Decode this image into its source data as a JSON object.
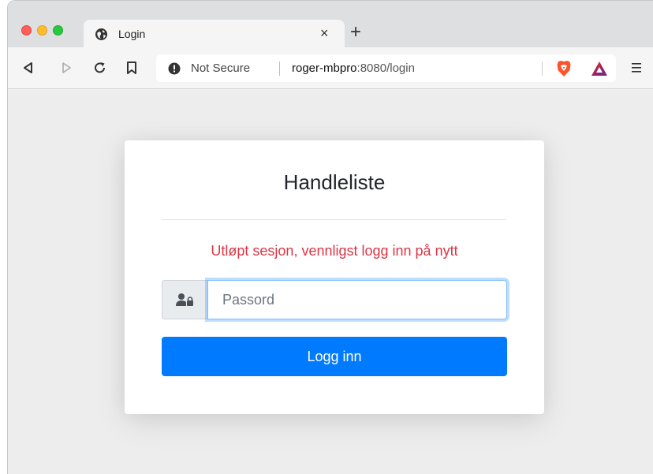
{
  "browser": {
    "tab": {
      "title": "Login",
      "close": "×"
    },
    "new_tab": "+",
    "omnibox": {
      "security_text": "Not Secure",
      "url_host": "roger-mbpro",
      "url_rest": ":8080/login"
    },
    "icons": {
      "favicon": "globe-icon",
      "security": "info-circle-icon",
      "brave": "brave-shield-icon",
      "rewards": "brave-rewards-triangle-icon",
      "menu": "hamburger-menu-icon"
    }
  },
  "page": {
    "title": "Handleliste",
    "error": "Utløpt sesjon, vennligst logg inn på nytt",
    "password_placeholder": "Passord",
    "password_value": "",
    "login_label": "Logg inn",
    "colors": {
      "error": "#dc3545",
      "primary": "#007bff",
      "background": "#ededed"
    }
  }
}
